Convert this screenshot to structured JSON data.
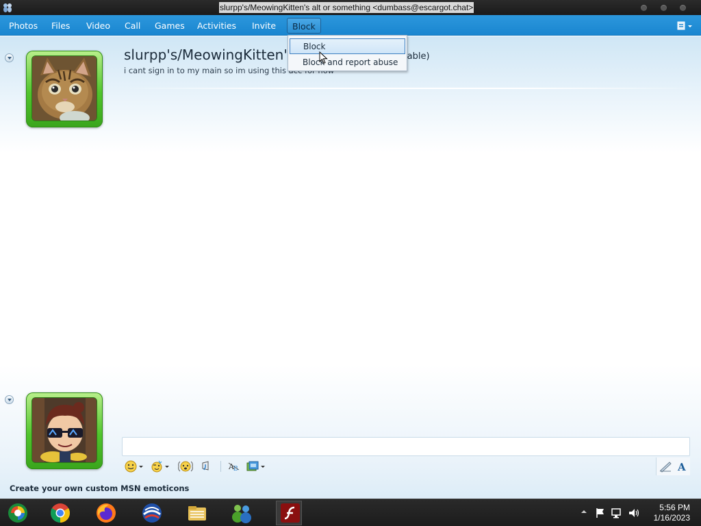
{
  "window": {
    "title": "slurpp's/MeowingKitten's alt or something <dumbass@escargot.chat>"
  },
  "menu": {
    "items": [
      "Photos",
      "Files",
      "Video",
      "Call",
      "Games",
      "Activities",
      "Invite",
      "Block"
    ],
    "active": "Block"
  },
  "dropdown": {
    "items": [
      "Block",
      "Block and report abuse"
    ],
    "highlighted": "Block"
  },
  "contact": {
    "name": "slurpp's/MeowingKitten's a",
    "status_fragment": "lable)",
    "personal_message": "i cant sign in to my main so im using this acc for now"
  },
  "promo": {
    "text": "Create your own custom MSN emoticons"
  },
  "toolbar": {
    "icons": [
      "emoticon-icon",
      "wink-icon",
      "nudge-icon",
      "voice-clip-icon",
      "font-icon",
      "background-icon"
    ]
  },
  "taskbar": {
    "apps": [
      "media-center-icon",
      "chrome-icon",
      "firefox-icon",
      "msn-butterfly-icon",
      "file-explorer-icon",
      "windows-live-messenger-icon",
      "flash-icon"
    ],
    "time": "5:56 PM",
    "date": "1/16/2023"
  },
  "colors": {
    "menubar": "#1a86d0",
    "avatar_frame": "#51c52d",
    "dropdown_highlight": "#cfe5f8"
  }
}
